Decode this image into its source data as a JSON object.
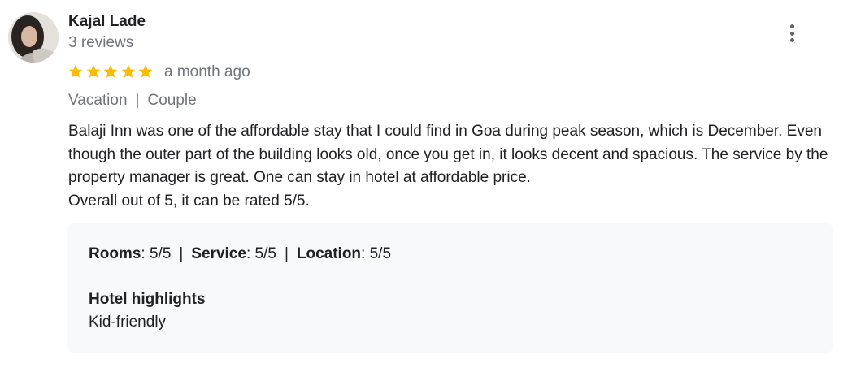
{
  "review": {
    "author": {
      "name": "Kajal Lade",
      "reviews_count": "3 reviews",
      "avatar_icon": "user-avatar-photo"
    },
    "rating": 5,
    "max_rating": 5,
    "star_color": "#fbbc04",
    "time": "a month ago",
    "trip_type": "Vacation",
    "travel_group": "Couple",
    "tag_separator": "|",
    "text_lines": [
      "Balaji Inn was one of the affordable stay that I could find in Goa during peak season, which is December. Even though the outer part of the building looks old, once you get in, it looks decent and spacious. The service by the property manager is great. One can stay in hotel at affordable price.",
      "Overall out of 5, it can be rated 5/5."
    ],
    "more_options_icon": "more-vert-icon",
    "details": {
      "ratings": [
        {
          "label": "Rooms",
          "value": "5/5"
        },
        {
          "label": "Service",
          "value": "5/5"
        },
        {
          "label": "Location",
          "value": "5/5"
        }
      ],
      "separator": "|",
      "highlights_title": "Hotel highlights",
      "highlights": "Kid-friendly"
    }
  }
}
